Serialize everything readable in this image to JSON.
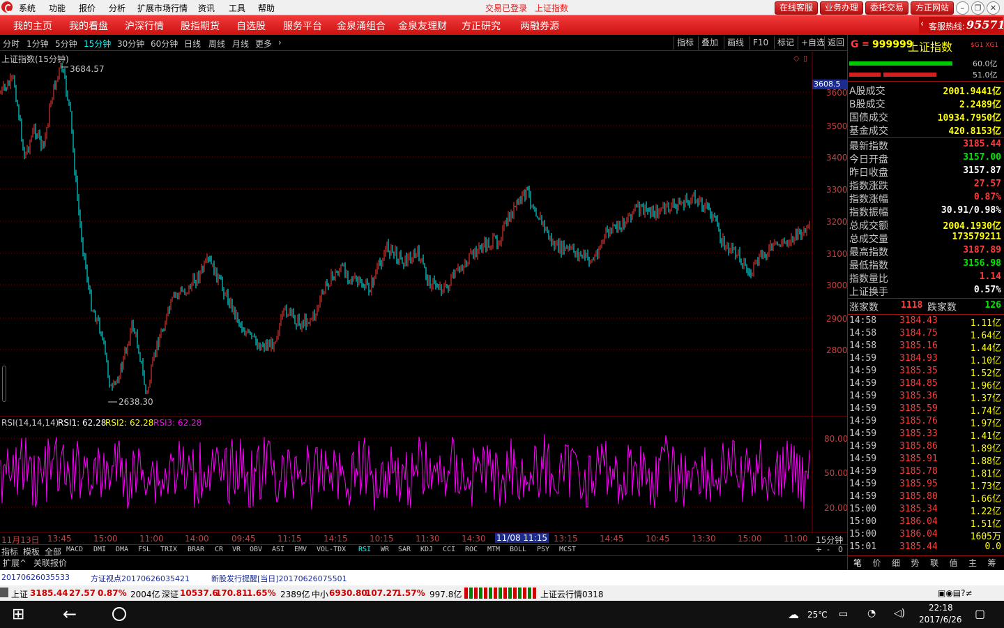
{
  "menubar": {
    "items": [
      "系统",
      "功能",
      "报价",
      "分析",
      "扩展市场行情",
      "资讯",
      "工具",
      "帮助"
    ],
    "status": "交易已登录",
    "title": "上证指数",
    "buttons": [
      "在线客服",
      "业务办理",
      "委托交易",
      "方正网站"
    ]
  },
  "nav": {
    "items": [
      "我的主页",
      "我的看盘",
      "沪深行情",
      "股指期货",
      "自选股",
      "服务平台",
      "金泉涌组合",
      "金泉友理财",
      "方正研究",
      "两融券源"
    ],
    "hotline_label": "客服热线:",
    "hotline_number": "95571"
  },
  "toolbar": {
    "periods": [
      "分时",
      "1分钟",
      "5分钟",
      "15分钟",
      "30分钟",
      "60分钟",
      "日线",
      "周线",
      "月线",
      "更多"
    ],
    "active_period": "15分钟",
    "buttons": [
      "指标",
      "叠加",
      "画线",
      "F10",
      "标记",
      "+自选",
      "返回"
    ]
  },
  "main_chart": {
    "title": "上证指数(15分钟)",
    "high_label": "3684.57",
    "low_label": "2638.30",
    "current_tag": "3608.5",
    "y_ticks": [
      "3600",
      "3500",
      "3400",
      "3300",
      "3200",
      "3100",
      "3000",
      "2900",
      "2800"
    ],
    "colors": {
      "up": "#ff3c3c",
      "down": "#00ffff",
      "grid": "#800000",
      "rsi": "#ff00ff"
    }
  },
  "rsi": {
    "label": "RSI(14,14,14)",
    "rsi1": "RSI1: 62.28",
    "rsi2": "RSI2: 62.28",
    "rsi3": "RSI3: 62.28",
    "y_ticks": [
      "80.00",
      "50.00",
      "20.00"
    ]
  },
  "xaxis": {
    "labels": [
      "11月13日",
      "13:45",
      "15:00",
      "11:00",
      "14:00",
      "09:45",
      "11:15",
      "14:15",
      "10:15",
      "11:30",
      "14:30",
      "11/08 11:15",
      "13:15",
      "14:45",
      "10:45",
      "13:30",
      "15:00",
      "11:00"
    ],
    "period": "15分钟",
    "highlight": "11/08 11:15"
  },
  "indicator_tabs": [
    "指标",
    "模板",
    "全部",
    "MACD",
    "DMI",
    "DMA",
    "FSL",
    "TRIX",
    "BRAR",
    "CR",
    "VR",
    "OBV",
    "ASI",
    "EMV",
    "VOL-TDX",
    "RSI",
    "WR",
    "SAR",
    "KDJ",
    "CCI",
    "ROC",
    "MTM",
    "BOLL",
    "PSY",
    "MCST"
  ],
  "sub_tabs": [
    "扩展^",
    "关联报价"
  ],
  "zoom_buttons": [
    "+",
    "-",
    "0"
  ],
  "quote": {
    "code": "999999",
    "name": "上证指数",
    "tag": "$G1 XG1",
    "bar1_pct": "60.0亿",
    "bar2_pct": "51.0亿",
    "turnover": [
      {
        "label": "A股成交",
        "value": "2001.9441亿"
      },
      {
        "label": "B股成交",
        "value": "2.2489亿"
      },
      {
        "label": "国债成交",
        "value": "10934.7950亿"
      },
      {
        "label": "基金成交",
        "value": "420.8153亿"
      }
    ],
    "stats": [
      {
        "label": "最新指数",
        "value": "3185.44",
        "color": "#ff3c3c"
      },
      {
        "label": "今日开盘",
        "value": "3157.00",
        "color": "#00e600"
      },
      {
        "label": "昨日收盘",
        "value": "3157.87",
        "color": "#ffffff"
      },
      {
        "label": "指数涨跌",
        "value": "27.57",
        "color": "#ff3c3c"
      },
      {
        "label": "指数涨幅",
        "value": "0.87%",
        "color": "#ff3c3c"
      },
      {
        "label": "指数振幅",
        "value": "30.91/0.98%",
        "color": "#ffffff"
      },
      {
        "label": "总成交额",
        "value": "2004.1930亿",
        "color": "#ffff00"
      },
      {
        "label": "总成交量",
        "value": "173579211",
        "color": "#ffff00"
      },
      {
        "label": "最高指数",
        "value": "3187.89",
        "color": "#ff3c3c"
      },
      {
        "label": "最低指数",
        "value": "3156.98",
        "color": "#00e600"
      },
      {
        "label": "指数量比",
        "value": "1.14",
        "color": "#ff3c3c"
      },
      {
        "label": "上证换手",
        "value": "0.57%",
        "color": "#ffffff"
      }
    ],
    "advance_label": "涨家数",
    "advance_count": "1118",
    "decline_label": "跌家数",
    "decline_count": "126",
    "ticks": [
      {
        "t": "14:58",
        "p": "3184.43",
        "v": "1.11亿"
      },
      {
        "t": "14:58",
        "p": "3184.75",
        "v": "1.64亿"
      },
      {
        "t": "14:58",
        "p": "3185.16",
        "v": "1.44亿"
      },
      {
        "t": "14:59",
        "p": "3184.93",
        "v": "1.10亿"
      },
      {
        "t": "14:59",
        "p": "3185.35",
        "v": "1.52亿"
      },
      {
        "t": "14:59",
        "p": "3184.85",
        "v": "1.96亿"
      },
      {
        "t": "14:59",
        "p": "3185.36",
        "v": "1.37亿"
      },
      {
        "t": "14:59",
        "p": "3185.59",
        "v": "1.74亿"
      },
      {
        "t": "14:59",
        "p": "3185.76",
        "v": "1.97亿"
      },
      {
        "t": "14:59",
        "p": "3185.33",
        "v": "1.41亿"
      },
      {
        "t": "14:59",
        "p": "3185.86",
        "v": "1.89亿"
      },
      {
        "t": "14:59",
        "p": "3185.91",
        "v": "1.88亿"
      },
      {
        "t": "14:59",
        "p": "3185.78",
        "v": "1.81亿"
      },
      {
        "t": "14:59",
        "p": "3185.95",
        "v": "1.73亿"
      },
      {
        "t": "14:59",
        "p": "3185.80",
        "v": "1.66亿"
      },
      {
        "t": "15:00",
        "p": "3185.34",
        "v": "1.22亿"
      },
      {
        "t": "15:00",
        "p": "3186.04",
        "v": "1.51亿"
      },
      {
        "t": "15:00",
        "p": "3186.04",
        "v": "1605万"
      },
      {
        "t": "15:01",
        "p": "3185.44",
        "v": "0.0"
      }
    ],
    "bottom_tabs": [
      "笔",
      "价",
      "细",
      "势",
      "联",
      "值",
      "主",
      "筹"
    ]
  },
  "news": [
    "20170626035533",
    "方证视点20170626035421",
    "新股发行提醒[当日]20170626075501"
  ],
  "status": {
    "sh_label": "上证",
    "sh_price": "3185.44",
    "sh_chg": "27.57",
    "sh_pct": "0.87%",
    "sh_amt": "2004亿",
    "sz_label": "深证",
    "sz_price": "10537.6",
    "sz_chg": "170.81",
    "sz_pct": "1.65%",
    "sz_amt": "2389亿",
    "zx_label": "中小",
    "zx_price": "6930.80",
    "zx_chg": "107.27",
    "zx_pct": "1.57%",
    "zx_amt": "997.8亿",
    "cloud": "上证云行情0318"
  },
  "taskbar": {
    "temp": "25℃",
    "time": "22:18",
    "date": "2017/6/26"
  }
}
